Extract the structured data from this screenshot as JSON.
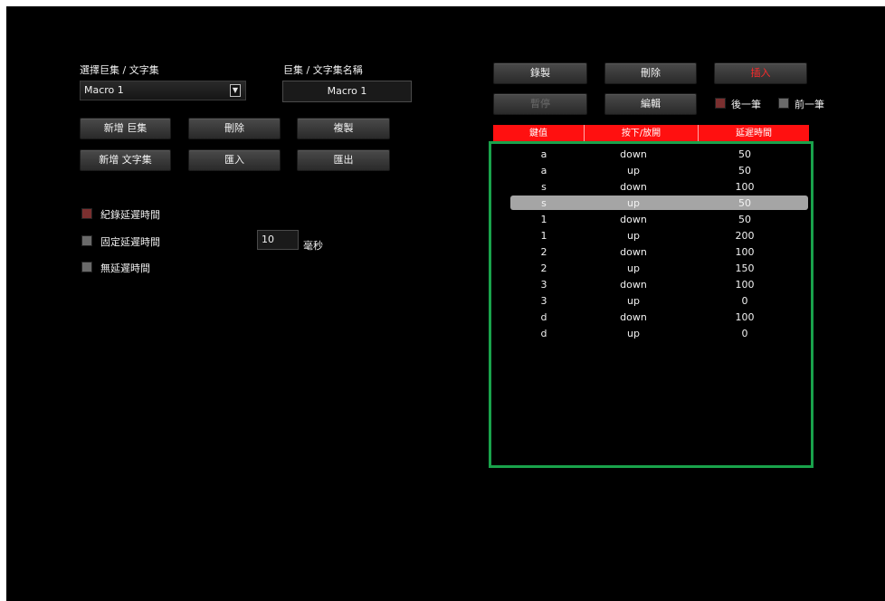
{
  "left_panel": {
    "select_label": "選擇巨集 / 文字集",
    "select_value": "Macro 1",
    "name_label": "巨集 / 文字集名稱",
    "name_value": "Macro 1",
    "buttons": {
      "new_macro": "新增 巨集",
      "delete": "刪除",
      "copy": "複製",
      "new_text": "新增 文字集",
      "import": "匯入",
      "export": "匯出"
    },
    "delay_options": {
      "record": "紀錄延遲時間",
      "fixed": "固定延遲時間",
      "fixed_value": "10",
      "fixed_unit": "毫秒",
      "none": "無延遲時間"
    }
  },
  "right_panel": {
    "buttons": {
      "record": "錄製",
      "delete": "刪除",
      "insert": "插入",
      "pause": "暫停",
      "edit": "編輯"
    },
    "position": {
      "after": "後一筆",
      "before": "前一筆"
    },
    "table": {
      "headers": [
        "鍵值",
        "按下/放開",
        "延遲時間"
      ],
      "rows": [
        {
          "key": "a",
          "action": "down",
          "delay": "50"
        },
        {
          "key": "a",
          "action": "up",
          "delay": "50"
        },
        {
          "key": "s",
          "action": "down",
          "delay": "100"
        },
        {
          "key": "s",
          "action": "up",
          "delay": "50"
        },
        {
          "key": "1",
          "action": "down",
          "delay": "50"
        },
        {
          "key": "1",
          "action": "up",
          "delay": "200"
        },
        {
          "key": "2",
          "action": "down",
          "delay": "100"
        },
        {
          "key": "2",
          "action": "up",
          "delay": "150"
        },
        {
          "key": "3",
          "action": "down",
          "delay": "100"
        },
        {
          "key": "3",
          "action": "up",
          "delay": "0"
        },
        {
          "key": "d",
          "action": "down",
          "delay": "100"
        },
        {
          "key": "d",
          "action": "up",
          "delay": "0"
        }
      ],
      "selected_index": 3
    }
  },
  "colors": {
    "background": "#000000",
    "header_red": "#ff1010",
    "highlight_green": "#19a24b",
    "selected_row": "#a5a5a5",
    "checkbox_on": "#7a2f2f",
    "checkbox_off": "#6a6a6a"
  }
}
